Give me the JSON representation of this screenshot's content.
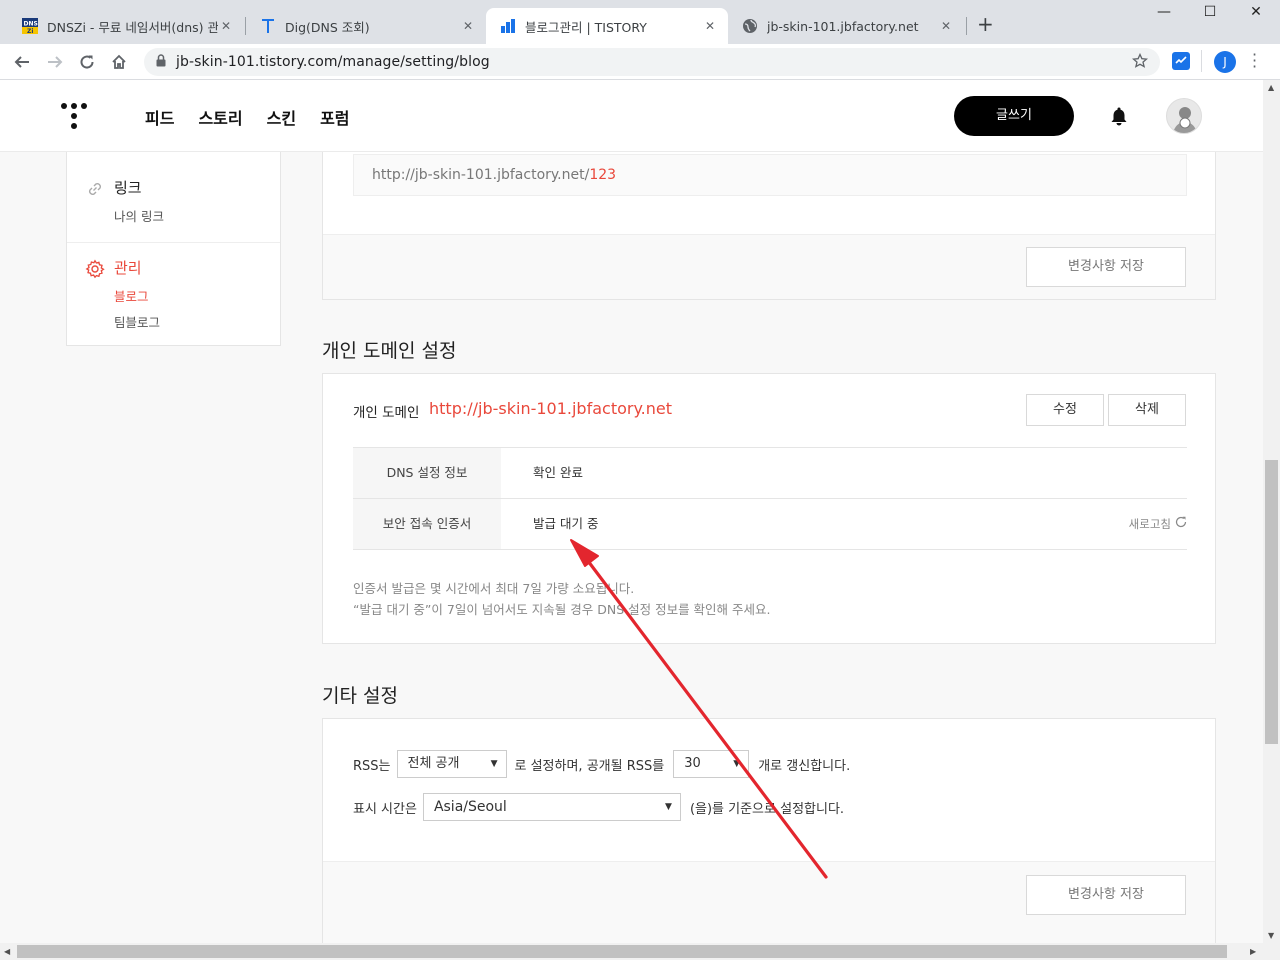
{
  "browser": {
    "tabs": [
      {
        "title": "DNSZi - 무료 네임서버(dns) 관리",
        "favicon": "dnszi-icon"
      },
      {
        "title": "Dig(DNS 조회)",
        "favicon": "t-icon"
      },
      {
        "title": "블로그관리 | TISTORY",
        "favicon": "tistory-icon"
      },
      {
        "title": "jb-skin-101.jbfactory.net",
        "favicon": "globe-icon"
      }
    ],
    "new_tab_label": "+",
    "url": "jb-skin-101.tistory.com/manage/setting/blog",
    "profile_initial": "J",
    "window_controls": [
      "—",
      "☐",
      "✕"
    ]
  },
  "header": {
    "nav": [
      "피드",
      "스토리",
      "스킨",
      "포럼"
    ],
    "write_label": "글쓰기"
  },
  "sidebar": {
    "link_title": "링크",
    "link_sub": "나의 링크",
    "manage_title": "관리",
    "manage_items": [
      "블로그",
      "팀블로그"
    ]
  },
  "address_section": {
    "url_prefix": "http://jb-skin-101.jbfactory.net/",
    "url_suffix": "123",
    "save_label": "변경사항 저장"
  },
  "domain_section": {
    "title": "개인 도메인 설정",
    "label": "개인 도메인",
    "domain": "http://jb-skin-101.jbfactory.net",
    "edit_label": "수정",
    "delete_label": "삭제",
    "rows": [
      {
        "key": "DNS 설정 정보",
        "value": "확인 완료"
      },
      {
        "key": "보안 접속 인증서",
        "value": "발급 대기 중"
      }
    ],
    "refresh_label": "새로고침",
    "notes": [
      "인증서 발급은 몇 시간에서 최대 7일 가량 소요됩니다.",
      "“발급 대기 중”이 7일이 넘어서도 지속될 경우 DNS 설정 정보를 확인해 주세요."
    ]
  },
  "etc_section": {
    "title": "기타 설정",
    "rss_prefix": "RSS는",
    "rss_select": "전체 공개",
    "rss_middle": "로 설정하며, 공개될 RSS를",
    "rss_count": "30",
    "rss_suffix": "개로 갱신합니다.",
    "tz_prefix": "표시 시간은",
    "tz_select": "Asia/Seoul",
    "tz_suffix": "(을)를 기준으로 설정합니다.",
    "save_label": "변경사항 저장"
  },
  "colors": {
    "accent": "#e9483b",
    "annotation_arrow": "#e3262e"
  }
}
